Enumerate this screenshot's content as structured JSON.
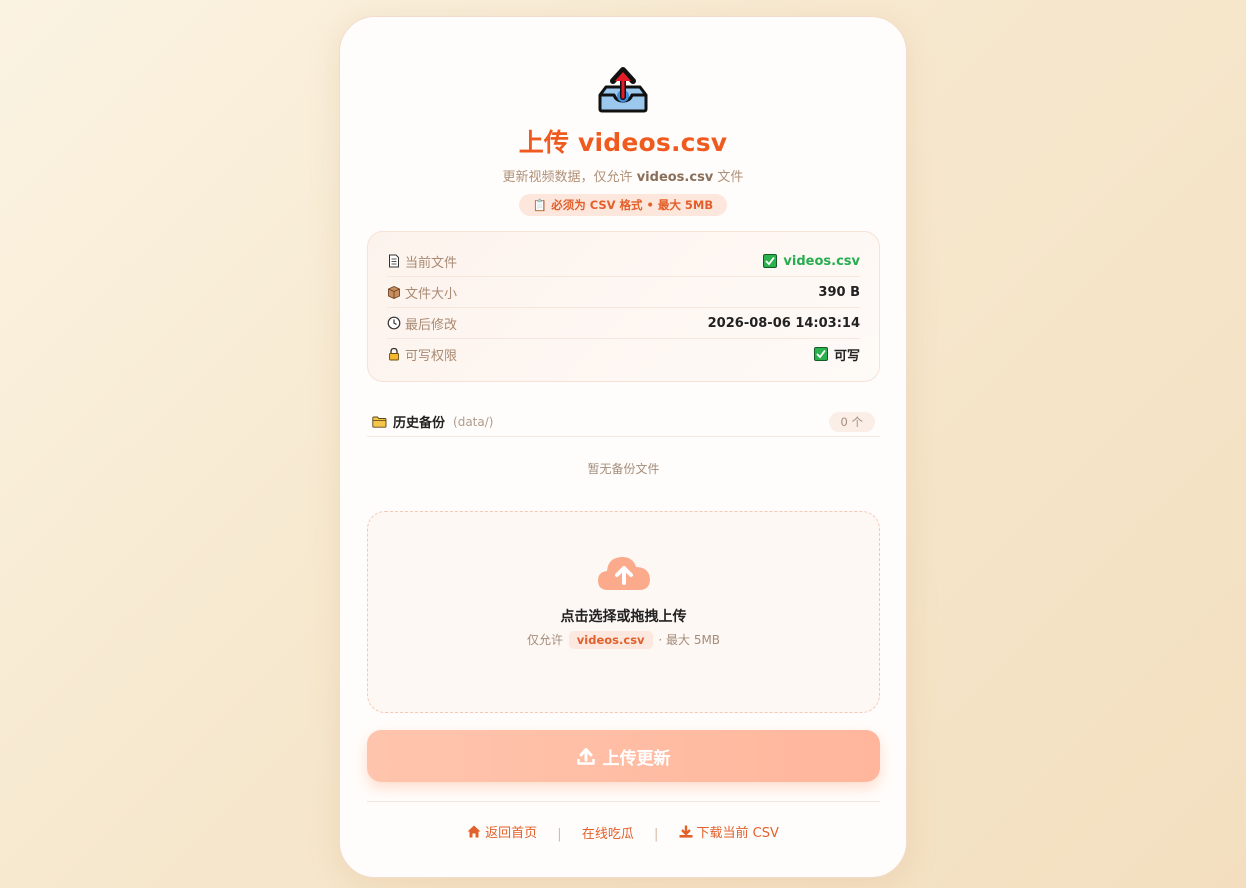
{
  "header": {
    "icon": "outbox-upload-icon",
    "title": "上传 videos.csv",
    "subtitle_prefix": "更新视频数据，仅允许",
    "subtitle_file": "videos.csv",
    "subtitle_suffix": "文件",
    "requirement_pill": "必须为 CSV 格式 • 最大 5MB",
    "accent_color": "#ef5a1f"
  },
  "file_info": {
    "rows": [
      {
        "icon": "document-icon",
        "label": "当前文件",
        "value": "videos.csv",
        "status": "check"
      },
      {
        "icon": "box-icon",
        "label": "文件大小",
        "value": "390 B"
      },
      {
        "icon": "clock-icon",
        "label": "最后修改",
        "value": "2026-08-06 14:03:14"
      },
      {
        "icon": "lock-icon",
        "label": "可写权限",
        "value": "可写",
        "status": "check"
      }
    ]
  },
  "backups": {
    "title": "历史备份",
    "path": "(data/)",
    "count": "0 个",
    "empty_text": "暂无备份文件"
  },
  "dropzone": {
    "icon": "cloud-upload-icon",
    "title": "点击选择或拖拽上传",
    "hint_prefix": "仅允许",
    "hint_file": "videos.csv",
    "hint_suffix": "· 最大 5MB"
  },
  "upload_button": {
    "label": "上传更新",
    "icon": "upload-icon"
  },
  "footer": {
    "home": "返回首页",
    "separator": "|",
    "gossip": "在线吃瓜",
    "download": "下载当前 CSV"
  }
}
